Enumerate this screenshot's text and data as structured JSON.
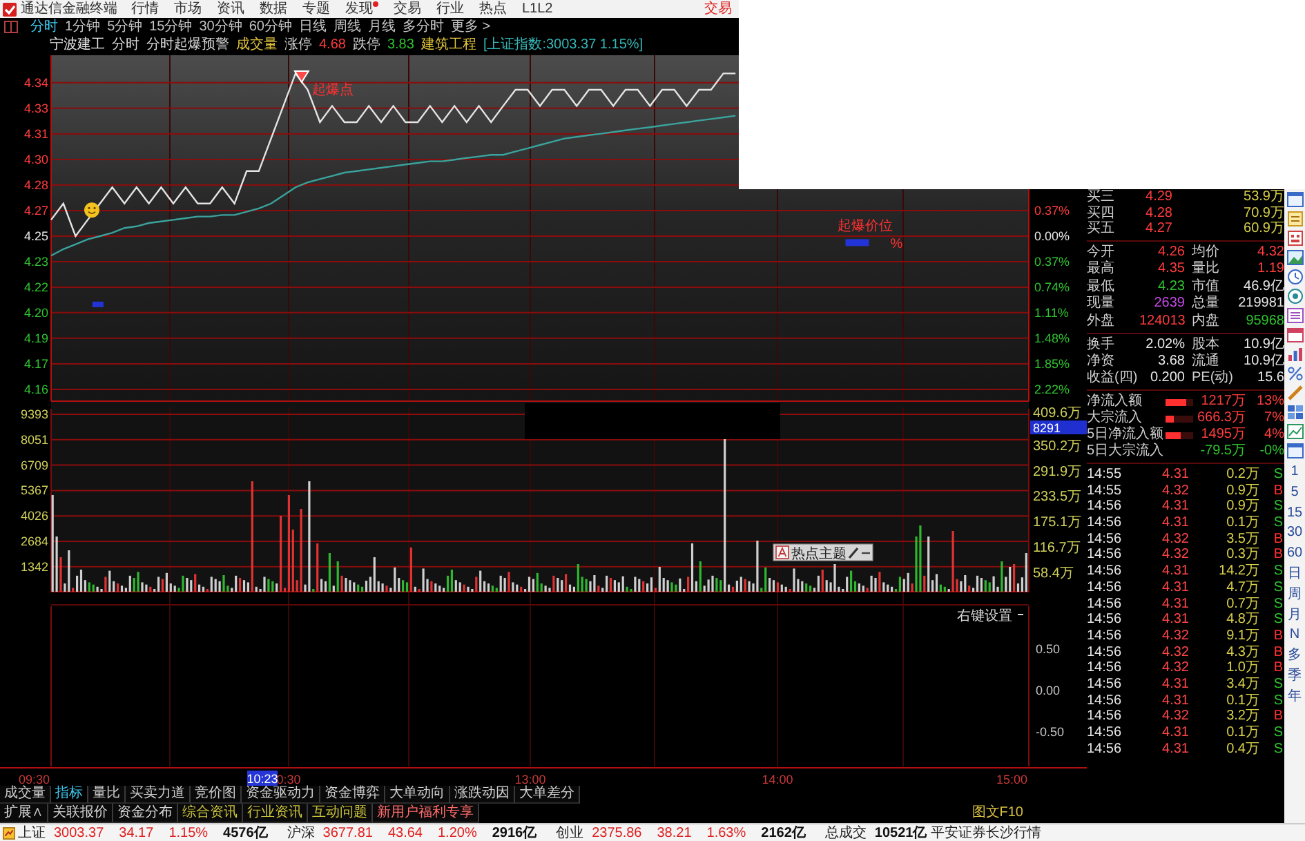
{
  "menu_bar": {
    "title": "通达信金融终端",
    "items": [
      {
        "label": "行情",
        "dot": false
      },
      {
        "label": "市场",
        "dot": false
      },
      {
        "label": "资讯",
        "dot": false
      },
      {
        "label": "数据",
        "dot": false
      },
      {
        "label": "专题",
        "dot": false
      },
      {
        "label": "发现",
        "dot": true
      },
      {
        "label": "交易",
        "dot": false
      },
      {
        "label": "行业",
        "dot": false
      },
      {
        "label": "热点",
        "dot": false
      },
      {
        "label": "L1L2",
        "dot": false
      }
    ],
    "trade_link": "交易"
  },
  "period_tabs": [
    {
      "label": "分时",
      "selected": true
    },
    {
      "label": "1分钟",
      "selected": false
    },
    {
      "label": "5分钟",
      "selected": false
    },
    {
      "label": "15分钟",
      "selected": false
    },
    {
      "label": "30分钟",
      "selected": false
    },
    {
      "label": "60分钟",
      "selected": false
    },
    {
      "label": "日线",
      "selected": false
    },
    {
      "label": "周线",
      "selected": false
    },
    {
      "label": "月线",
      "selected": false
    },
    {
      "label": "多分时",
      "selected": false
    },
    {
      "label": "更多 >",
      "selected": false
    }
  ],
  "stock_header": [
    {
      "text": "宁波建工",
      "kind": "name"
    },
    {
      "text": "分时",
      "kind": "plain"
    },
    {
      "text": "分时起爆预警",
      "kind": "plain"
    },
    {
      "text": "成交量",
      "kind": "accent"
    },
    {
      "text": "涨停",
      "kind": "plain"
    },
    {
      "text": "4.68",
      "kind": "up"
    },
    {
      "text": "跌停",
      "kind": "plain"
    },
    {
      "text": "3.83",
      "kind": "down"
    },
    {
      "text": "建筑工程",
      "kind": "accent"
    },
    {
      "text": "[上证指数:3003.37 1.15%]",
      "kind": "index"
    }
  ],
  "price_chart": {
    "chart_data": {
      "type": "line",
      "categories": [
        null,
        null,
        null,
        null,
        null,
        null,
        null,
        null,
        null,
        null,
        null,
        null,
        null,
        null,
        null,
        null,
        null,
        null,
        null,
        null,
        null,
        null,
        null,
        null,
        null,
        null,
        null,
        null,
        null,
        null,
        null,
        null,
        null,
        null,
        null,
        null,
        null,
        null,
        null,
        null,
        null,
        null,
        null,
        null,
        null,
        null,
        null,
        null,
        null,
        null,
        null,
        null,
        null,
        null,
        null,
        null,
        null,
        null,
        null,
        null,
        null,
        null,
        null,
        null,
        null,
        null,
        null,
        null,
        null,
        null,
        null,
        null,
        null,
        null,
        null,
        null,
        null,
        null,
        null,
        null,
        null
      ],
      "series": [
        {
          "color": "#e4e4e4",
          "values": [
            4.26,
            4.27,
            4.25,
            4.26,
            4.27,
            4.28,
            4.27,
            4.28,
            4.27,
            4.28,
            4.27,
            4.28,
            4.27,
            4.27,
            4.28,
            4.27,
            4.29,
            4.29,
            4.31,
            4.33,
            4.35,
            4.34,
            4.32,
            4.33,
            4.32,
            4.32,
            4.33,
            4.32,
            4.33,
            4.32,
            4.32,
            4.33,
            4.32,
            4.33,
            4.32,
            4.33,
            4.32,
            4.33,
            4.34,
            4.34,
            4.33,
            4.34,
            4.34,
            4.33,
            4.34,
            4.34,
            4.33,
            4.34,
            4.34,
            4.33,
            4.34,
            4.34,
            4.33,
            4.34,
            4.34,
            4.35,
            4.35,
            null,
            null,
            null,
            null,
            null,
            null,
            null,
            null,
            null,
            null,
            null,
            null,
            null,
            null,
            null,
            null,
            null,
            null,
            null,
            null,
            null,
            null,
            null,
            null
          ]
        },
        {
          "color": "#3aa39d",
          "values": [
            4.238,
            4.242,
            4.245,
            4.248,
            4.25,
            4.252,
            4.255,
            4.256,
            4.258,
            4.259,
            4.26,
            4.261,
            4.262,
            4.262,
            4.263,
            4.263,
            4.265,
            4.267,
            4.27,
            4.275,
            4.28,
            4.283,
            4.285,
            4.287,
            4.289,
            4.29,
            4.291,
            4.292,
            4.293,
            4.294,
            4.295,
            4.296,
            4.296,
            4.297,
            4.298,
            4.299,
            4.3,
            4.3,
            4.302,
            4.304,
            4.306,
            4.308,
            4.31,
            4.311,
            4.312,
            4.313,
            4.314,
            4.315,
            4.316,
            4.317,
            4.318,
            4.319,
            4.32,
            4.321,
            4.322,
            4.323,
            4.324,
            null,
            null,
            null,
            null,
            null,
            null,
            null,
            null,
            null,
            null,
            null,
            null,
            null,
            null,
            null,
            null,
            null,
            null,
            null,
            null,
            null,
            null,
            null,
            null
          ]
        }
      ],
      "ylim": [
        4.1485,
        4.3612
      ],
      "yticks": [
        {
          "value": 4.3443,
          "label": "4.34"
        },
        {
          "value": 4.3286,
          "label": "4.33"
        },
        {
          "value": 4.3128,
          "label": "4.31"
        },
        {
          "value": 4.2971,
          "label": "4.30"
        },
        {
          "value": 4.2814,
          "label": "4.28"
        },
        {
          "value": 4.2657,
          "label": "4.27"
        },
        {
          "value": 4.25,
          "label": "4.25"
        },
        {
          "value": 4.2343,
          "label": "4.23"
        },
        {
          "value": 4.2186,
          "label": "4.22"
        },
        {
          "value": 4.2029,
          "label": "4.20"
        },
        {
          "value": 4.1872,
          "label": "4.19"
        },
        {
          "value": 4.1714,
          "label": "4.17"
        },
        {
          "value": 4.1557,
          "label": "4.16"
        }
      ],
      "grid": true,
      "annotations": [
        "起爆点",
        "起爆价位",
        "%"
      ]
    },
    "percent_axis": [
      {
        "label": "0.37%",
        "kind": "up"
      },
      {
        "label": "0.00%",
        "kind": "flat"
      },
      {
        "label": "0.37%",
        "kind": "down"
      },
      {
        "label": "0.74%",
        "kind": "down"
      },
      {
        "label": "1.11%",
        "kind": "down"
      },
      {
        "label": "1.48%",
        "kind": "down"
      },
      {
        "label": "1.85%",
        "kind": "down"
      },
      {
        "label": "2.22%",
        "kind": "down"
      }
    ],
    "time_axis": [
      "09:30",
      "0:30",
      "13:00",
      "14:00",
      "15:00"
    ],
    "cursor": {
      "label": "10:23"
    }
  },
  "volume_pane": {
    "ticks": [
      "9393",
      "8051",
      "6709",
      "5367",
      "4026",
      "2684",
      "1342"
    ],
    "right_ticks": [
      "409.6万",
      "350.2万",
      "291.9万",
      "233.5万",
      "175.1万",
      "116.7万",
      "58.4万"
    ],
    "cursor_value": "8291"
  },
  "floating_toolbar": {
    "label": "热点主题"
  },
  "indicator_pane": {
    "ticks": [
      "0.50",
      "0.00",
      "-0.50"
    ],
    "settings": "右键设置"
  },
  "quote_panel": {
    "order_book": [
      {
        "label": "买三",
        "price": "4.29",
        "volume": "53.9万"
      },
      {
        "label": "买四",
        "price": "4.28",
        "volume": "70.9万"
      },
      {
        "label": "买五",
        "price": "4.27",
        "volume": "60.9万"
      }
    ],
    "stats": [
      [
        {
          "label": "今开",
          "value": "4.26",
          "kind": "up"
        },
        {
          "label": "均价",
          "value": "4.32",
          "kind": "up"
        }
      ],
      [
        {
          "label": "最高",
          "value": "4.35",
          "kind": "up"
        },
        {
          "label": "量比",
          "value": "1.19",
          "kind": "up"
        }
      ],
      [
        {
          "label": "最低",
          "value": "4.23",
          "kind": "down"
        },
        {
          "label": "市值",
          "value": "46.9亿",
          "kind": "plain"
        }
      ],
      [
        {
          "label": "现量",
          "value": "2639",
          "kind": "current"
        },
        {
          "label": "总量",
          "value": "219981",
          "kind": "plain"
        }
      ],
      [
        {
          "label": "外盘",
          "value": "124013",
          "kind": "up"
        },
        {
          "label": "内盘",
          "value": "95968",
          "kind": "down"
        }
      ]
    ],
    "fundamentals": [
      [
        {
          "label": "换手",
          "value": "2.02%"
        },
        {
          "label": "股本",
          "value": "10.9亿"
        }
      ],
      [
        {
          "label": "净资",
          "value": "3.68"
        },
        {
          "label": "流通",
          "value": "10.9亿"
        }
      ],
      [
        {
          "label": "收益(四)",
          "value": "0.200"
        },
        {
          "label": "PE(动)",
          "value": "15.6"
        }
      ]
    ],
    "flows": [
      {
        "label": "净流入额",
        "level": 0.75,
        "value": "1217万",
        "percent": "13%",
        "kind": "up"
      },
      {
        "label": "大宗流入",
        "level": 0.3,
        "value": "666.3万",
        "percent": "7%",
        "kind": "up"
      },
      {
        "label": "5日净流入额",
        "level": 0.55,
        "value": "1495万",
        "percent": "4%",
        "kind": "up"
      },
      {
        "label": "5日大宗流入",
        "value": "-79.5万",
        "percent": "-0%",
        "kind": "down"
      }
    ],
    "trades": [
      {
        "time": "14:55",
        "price": "4.31",
        "volume": "0.2万",
        "side": "S",
        "kind": "sell"
      },
      {
        "time": "14:55",
        "price": "4.32",
        "volume": "0.9万",
        "side": "B",
        "kind": "buy"
      },
      {
        "time": "14:56",
        "price": "4.31",
        "volume": "0.9万",
        "side": "S",
        "kind": "sell"
      },
      {
        "time": "14:56",
        "price": "4.31",
        "volume": "0.1万",
        "side": "S",
        "kind": "sell"
      },
      {
        "time": "14:56",
        "price": "4.32",
        "volume": "3.5万",
        "side": "B",
        "kind": "buy"
      },
      {
        "time": "14:56",
        "price": "4.32",
        "volume": "0.3万",
        "side": "B",
        "kind": "buy"
      },
      {
        "time": "14:56",
        "price": "4.31",
        "volume": "14.2万",
        "side": "S",
        "kind": "sell"
      },
      {
        "time": "14:56",
        "price": "4.31",
        "volume": "4.7万",
        "side": "S",
        "kind": "sell"
      },
      {
        "time": "14:56",
        "price": "4.31",
        "volume": "0.7万",
        "side": "S",
        "kind": "sell"
      },
      {
        "time": "14:56",
        "price": "4.31",
        "volume": "4.8万",
        "side": "S",
        "kind": "sell"
      },
      {
        "time": "14:56",
        "price": "4.32",
        "volume": "9.1万",
        "side": "B",
        "kind": "buy"
      },
      {
        "time": "14:56",
        "price": "4.32",
        "volume": "4.3万",
        "side": "B",
        "kind": "buy"
      },
      {
        "time": "14:56",
        "price": "4.32",
        "volume": "1.0万",
        "side": "B",
        "kind": "buy"
      },
      {
        "time": "14:56",
        "price": "4.31",
        "volume": "3.4万",
        "side": "S",
        "kind": "sell"
      },
      {
        "time": "14:56",
        "price": "4.31",
        "volume": "0.1万",
        "side": "S",
        "kind": "sell"
      },
      {
        "time": "14:56",
        "price": "4.32",
        "volume": "3.2万",
        "side": "B",
        "kind": "buy"
      },
      {
        "time": "14:56",
        "price": "4.31",
        "volume": "0.1万",
        "side": "S",
        "kind": "sell"
      },
      {
        "time": "14:56",
        "price": "4.31",
        "volume": "0.4万",
        "side": "S",
        "kind": "sell"
      }
    ]
  },
  "side_toolbar": {
    "periods": [
      "1",
      "5",
      "15",
      "30",
      "60",
      "日",
      "周",
      "月",
      "N",
      "多",
      "季",
      "年"
    ]
  },
  "indicator_tabs": [
    {
      "label": "成交量",
      "selected": false
    },
    {
      "label": "指标",
      "selected": true
    },
    {
      "label": "量比",
      "selected": false
    },
    {
      "label": "买卖力道",
      "selected": false
    },
    {
      "label": "竞价图",
      "selected": false
    },
    {
      "label": "资金驱动力",
      "selected": false
    },
    {
      "label": "资金博弈",
      "selected": false
    },
    {
      "label": "大单动向",
      "selected": false
    },
    {
      "label": "涨跌动因",
      "selected": false
    },
    {
      "label": "大单差分",
      "selected": false
    }
  ],
  "info_tabs": [
    {
      "label": "扩展∧",
      "kind": "plain"
    },
    {
      "label": "关联报价",
      "kind": "plain"
    },
    {
      "label": "资金分布",
      "kind": "plain"
    },
    {
      "label": "综合资讯",
      "kind": "news"
    },
    {
      "label": "行业资讯",
      "kind": "news"
    },
    {
      "label": "互动问题",
      "kind": "news"
    },
    {
      "label": "新用户福利专享",
      "kind": "promo"
    }
  ],
  "f10_link": "图文F10",
  "status_bar": {
    "indices": [
      {
        "name": "上证",
        "value": "3003.37",
        "change": "34.17",
        "percent": "1.15%",
        "amount": "4576亿"
      },
      {
        "name": "沪深",
        "value": "3677.81",
        "change": "43.64",
        "percent": "1.20%",
        "amount": "2916亿"
      },
      {
        "name": "创业",
        "value": "2375.86",
        "change": "38.21",
        "percent": "1.63%",
        "amount": "2162亿"
      }
    ],
    "total_label": "总成交",
    "total_value": "10521亿",
    "broker": "平安证券长沙行情"
  }
}
